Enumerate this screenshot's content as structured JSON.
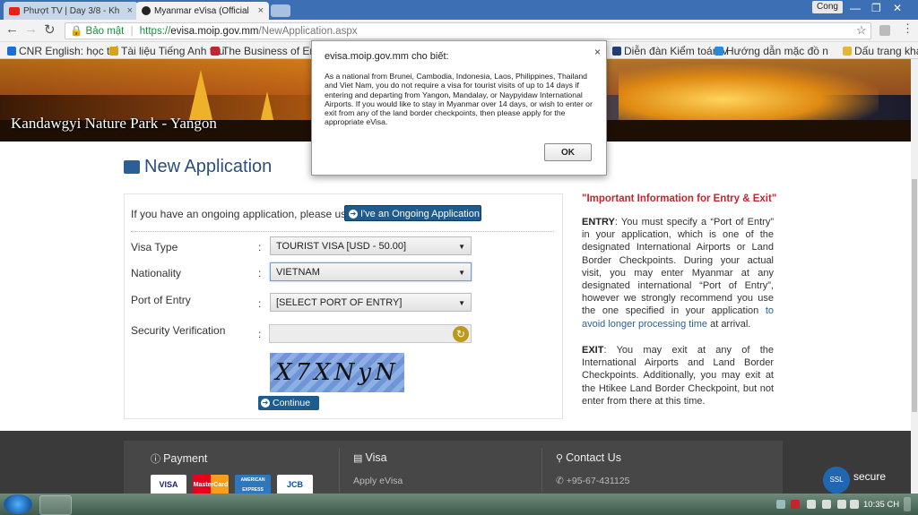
{
  "browser": {
    "tabs": [
      {
        "label": "Phượt TV | Day 3/8 - Kh",
        "icon": "youtube-icon",
        "color": "#e62117"
      },
      {
        "label": "Myanmar eVisa (Official",
        "icon": "site-icon",
        "color": "#222222"
      }
    ],
    "profile": "Cong",
    "secure_label": "Bảo mật",
    "url_scheme": "https://",
    "url_host": "evisa.moip.gov.mm",
    "url_path": "/NewApplication.aspx",
    "bookmarks": [
      {
        "label": "CNR English: học tiế",
        "color": "#1c6fce"
      },
      {
        "label": "Tài liệu Tiếng Anh thu",
        "color": "#d8a21c"
      },
      {
        "label": "The Business of Engl",
        "color": "#c0272d"
      },
      {
        "label": "Diễn đàn Kiểm toán V",
        "color": "#1e3f75"
      },
      {
        "label": "Hướng dẫn mặc đồ n",
        "color": "#2a8ad8"
      },
      {
        "label": "Dấu trang khác",
        "color": "#e3b53a"
      }
    ],
    "accent": "#3d6fb5"
  },
  "banner": {
    "caption": "Kandawgyi Nature Park - Yangon"
  },
  "page": {
    "title": "New Application",
    "ongoing_text": "If you have an ongoing application, please use.",
    "ongoing_button": "I've an Ongoing Application",
    "fields": {
      "visa_type_label": "Visa Type",
      "visa_type_value": "TOURIST VISA [USD - 50.00]",
      "nationality_label": "Nationality",
      "nationality_value": "VIETNAM",
      "port_label": "Port of Entry",
      "port_value": "[SELECT PORT OF ENTRY]",
      "security_label": "Security Verification",
      "captcha_text": "X7XNyN"
    },
    "colon": ":",
    "continue_button": "Continue",
    "primary_color": "#1e5b8e"
  },
  "info": {
    "title": "\"Important Information for Entry & Exit\"",
    "entry_label": "ENTRY",
    "entry_text": ": You must specify a “Port of Entry” in your application, which is one of the designated International Airports or Land Border Checkpoints. During your actual visit, you may enter Myanmar at any designated international “Port of Entry”, however we strongly recommend you use the one specified in your application ",
    "entry_link": "to avoid longer processing time",
    "entry_end": " at arrival.",
    "exit_label": "EXIT",
    "exit_text": ": You may exit at any of the International Airports and Land Border Checkpoints. Additionally, you may exit at the Htikee Land Border Checkpoint, but not enter from there at this time.",
    "title_color": "#c0272d"
  },
  "footer": {
    "payment_heading": "Payment",
    "visa_heading": "Visa",
    "visa_link": "Apply eVisa",
    "contact_heading": "Contact Us",
    "contact_phone": "+95-67-431125",
    "cards": [
      "VISA",
      "MasterCard",
      "AMERICAN EXPRESS",
      "JCB"
    ],
    "ssl_badge": "SSL",
    "ssl_text": "secure"
  },
  "dialog": {
    "title": "evisa.moip.gov.mm cho biết:",
    "message": "As a national from Brunei, Cambodia, Indonesia, Laos, Philippines, Thailand and Viet Nam, you do not require a visa for tourist visits of up to 14 days if entering and departing from Yangon, Mandalay, or Naypyidaw International Airports. If you would like to stay in Myanmar over 14 days, or wish to enter or exit from any of the land border checkpoints, then please apply for the appropriate eVisa.",
    "ok_label": "OK",
    "close_label": "×"
  },
  "taskbar": {
    "clock": "10:35 CH"
  }
}
